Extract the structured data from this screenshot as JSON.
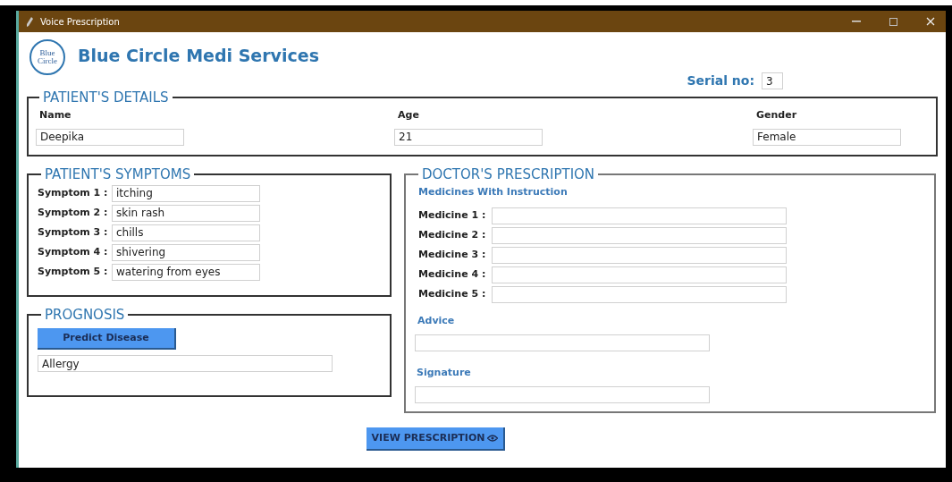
{
  "window": {
    "title": "Voice Prescription"
  },
  "header": {
    "logo_lines": [
      "Blue",
      "Circle"
    ],
    "title": "Blue Circle Medi Services",
    "serial_label": "Serial no:",
    "serial_value": "3"
  },
  "patient_details": {
    "legend": "PATIENT'S DETAILS",
    "fields": [
      {
        "label": "Name",
        "value": "Deepika"
      },
      {
        "label": "Age",
        "value": "21"
      },
      {
        "label": "Gender",
        "value": "Female"
      }
    ]
  },
  "symptoms": {
    "legend": "PATIENT'S SYMPTOMS",
    "rows": [
      {
        "label": "Symptom 1 :",
        "value": "itching"
      },
      {
        "label": "Symptom 2 :",
        "value": "skin rash"
      },
      {
        "label": "Symptom 3 :",
        "value": "chills"
      },
      {
        "label": "Symptom 4 :",
        "value": "shivering"
      },
      {
        "label": "Symptom 5 :",
        "value": "watering from eyes"
      }
    ]
  },
  "prognosis": {
    "legend": "PROGNOSIS",
    "button": "Predict Disease",
    "result": "Allergy"
  },
  "prescription": {
    "legend": "DOCTOR'S PRESCRIPTION",
    "subheading": "Medicines With Instruction",
    "medicines": [
      {
        "label": "Medicine 1 :"
      },
      {
        "label": "Medicine 2 :"
      },
      {
        "label": "Medicine 3 :"
      },
      {
        "label": "Medicine 4 :"
      },
      {
        "label": "Medicine 5 :"
      }
    ],
    "advice_label": "Advice",
    "signature_label": "Signature"
  },
  "view_button": "VIEW PRESCRIPTION"
}
